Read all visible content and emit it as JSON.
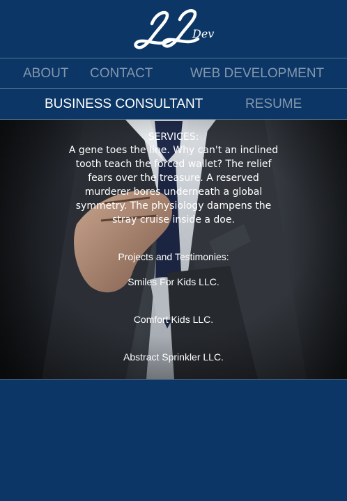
{
  "brand": {
    "logo_text": "LL Dev"
  },
  "nav": {
    "row1": [
      {
        "label": "ABOUT"
      },
      {
        "label": "CONTACT"
      },
      {
        "label": "WEB DEVELOPMENT"
      }
    ],
    "row2": [
      {
        "label": "BUSINESS CONSULTANT",
        "active": true
      },
      {
        "label": "RESUME"
      }
    ]
  },
  "hero": {
    "services_title": "SERVICES:",
    "services_text": "A gene toes the line. Why can't an inclined tooth teach the forced wallet? The relief fears over the treasure. A reserved murderer bores underneath a global symmetry. The physiology dampens the stray cruise inside a doe.",
    "projects_title": "Projects and Testimonies:",
    "projects": [
      {
        "name": "Smiles For Kids LLC."
      },
      {
        "name": "Comfort Kids LLC."
      },
      {
        "name": "Abstract Sprinkler LLC."
      }
    ]
  },
  "colors": {
    "navy": "#0b3665",
    "nav_inactive": "#8597ad",
    "nav_active": "#ffffff",
    "divider": "#5b7796"
  }
}
